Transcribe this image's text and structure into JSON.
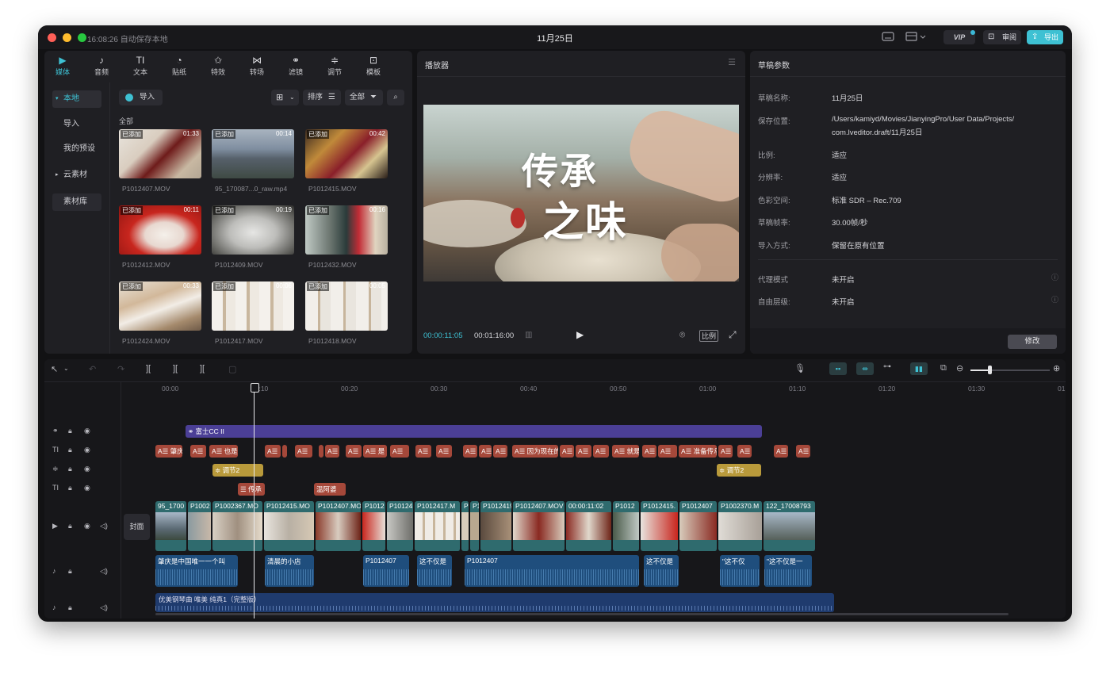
{
  "titlebar": {
    "autosave": "16:08:26 自动保存本地",
    "title": "11月25日",
    "vip_label": "VIP",
    "review_label": "审阅",
    "export_label": "导出"
  },
  "media_tabs": [
    {
      "label": "媒体",
      "icon": "media-icon",
      "glyph": "▶"
    },
    {
      "label": "音频",
      "icon": "audio-icon",
      "glyph": "♪"
    },
    {
      "label": "文本",
      "icon": "text-icon",
      "glyph": "TI"
    },
    {
      "label": "贴纸",
      "icon": "sticker-icon",
      "glyph": "◔"
    },
    {
      "label": "特效",
      "icon": "effects-icon",
      "glyph": "✩"
    },
    {
      "label": "转场",
      "icon": "transition-icon",
      "glyph": "⋈"
    },
    {
      "label": "滤镜",
      "icon": "filter-icon",
      "glyph": "⚭"
    },
    {
      "label": "调节",
      "icon": "adjust-icon",
      "glyph": "≑"
    },
    {
      "label": "模板",
      "icon": "template-icon",
      "glyph": "⊡"
    }
  ],
  "sidebar": {
    "local": "本地",
    "import": "导入",
    "presets": "我的预设",
    "cloud": "云素材",
    "library": "素材库"
  },
  "media": {
    "import_btn": "导入",
    "sort_btn": "排序",
    "all_btn": "全部",
    "section_label": "全部",
    "added_label": "已添加",
    "clips": [
      {
        "name": "P1012407.MOV",
        "duration": "01:33"
      },
      {
        "name": "95_170087...0_raw.mp4",
        "duration": "00:14"
      },
      {
        "name": "P1012415.MOV",
        "duration": "00:42"
      },
      {
        "name": "P1012412.MOV",
        "duration": "00:11"
      },
      {
        "name": "P1012409.MOV",
        "duration": "00:19"
      },
      {
        "name": "P1012432.MOV",
        "duration": "00:16"
      },
      {
        "name": "P1012424.MOV",
        "duration": "00:33"
      },
      {
        "name": "P1012417.MOV",
        "duration": "00:06"
      },
      {
        "name": "P1012418.MOV",
        "duration": "00:05"
      }
    ]
  },
  "player": {
    "title": "播放器",
    "current_time": "00:00:11:05",
    "total_time": "00:01:16:00",
    "ratio_btn": "比例",
    "video_title_line1": "传承",
    "video_title_line2": "之味"
  },
  "draft": {
    "title": "草稿参数",
    "rows": [
      {
        "label": "草稿名称:",
        "value": "11月25日"
      },
      {
        "label": "保存位置:",
        "value": "/Users/kamiyd/Movies/JianyingPro/User Data/Projects/",
        "value2": "com.lveditor.draft/11月25日"
      },
      {
        "label": "比例:",
        "value": "适应"
      },
      {
        "label": "分辨率:",
        "value": "适应"
      },
      {
        "label": "色彩空间:",
        "value": "标准 SDR – Rec.709"
      },
      {
        "label": "草稿帧率:",
        "value": "30.00帧/秒"
      },
      {
        "label": "导入方式:",
        "value": "保留在原有位置"
      },
      {
        "label": "代理模式",
        "value": "未开启"
      },
      {
        "label": "自由层级:",
        "value": "未开启"
      }
    ],
    "modify_btn": "修改"
  },
  "timeline": {
    "ruler": [
      "00:00",
      "00:10",
      "00:20",
      "00:30",
      "00:40",
      "00:50",
      "01:00",
      "01:10",
      "01:20",
      "01:30",
      "01:4"
    ],
    "filter_clip": "富士CC II",
    "text_clips": [
      "肇庆",
      "",
      "也是",
      "",
      "",
      "",
      "",
      "是",
      "",
      "",
      "",
      "",
      "",
      "",
      "因为现在的",
      "",
      "",
      "",
      "就是",
      "",
      "",
      "准备传承",
      "",
      "",
      "",
      ""
    ],
    "adjust_clips": [
      "调节2",
      "调节2"
    ],
    "sub_clips": [
      "传承",
      "温阿婆"
    ],
    "cover_btn": "封面",
    "video_clips": [
      "95_1700",
      "P1002",
      "P1002367.MO",
      "P1012415.MO",
      "P1012407.MO",
      "P1012",
      "P10124",
      "P1012417.M",
      "P",
      "P10",
      "P1012419",
      "P1012407.MOV",
      "00:00:11:02",
      "P1012",
      "P1012415.",
      "P1012407",
      "P1002370.M",
      "122_17008793"
    ],
    "audio_clips": [
      "肇庆是中国唯一一个叫",
      "清晨的小店",
      "P1012407",
      "这不仅是",
      "P1012407",
      "这不仅是",
      "\"这不仅",
      "\"这不仅是一"
    ],
    "music_clip": "优美钢琴曲 唯美 纯真1（完整版）"
  }
}
